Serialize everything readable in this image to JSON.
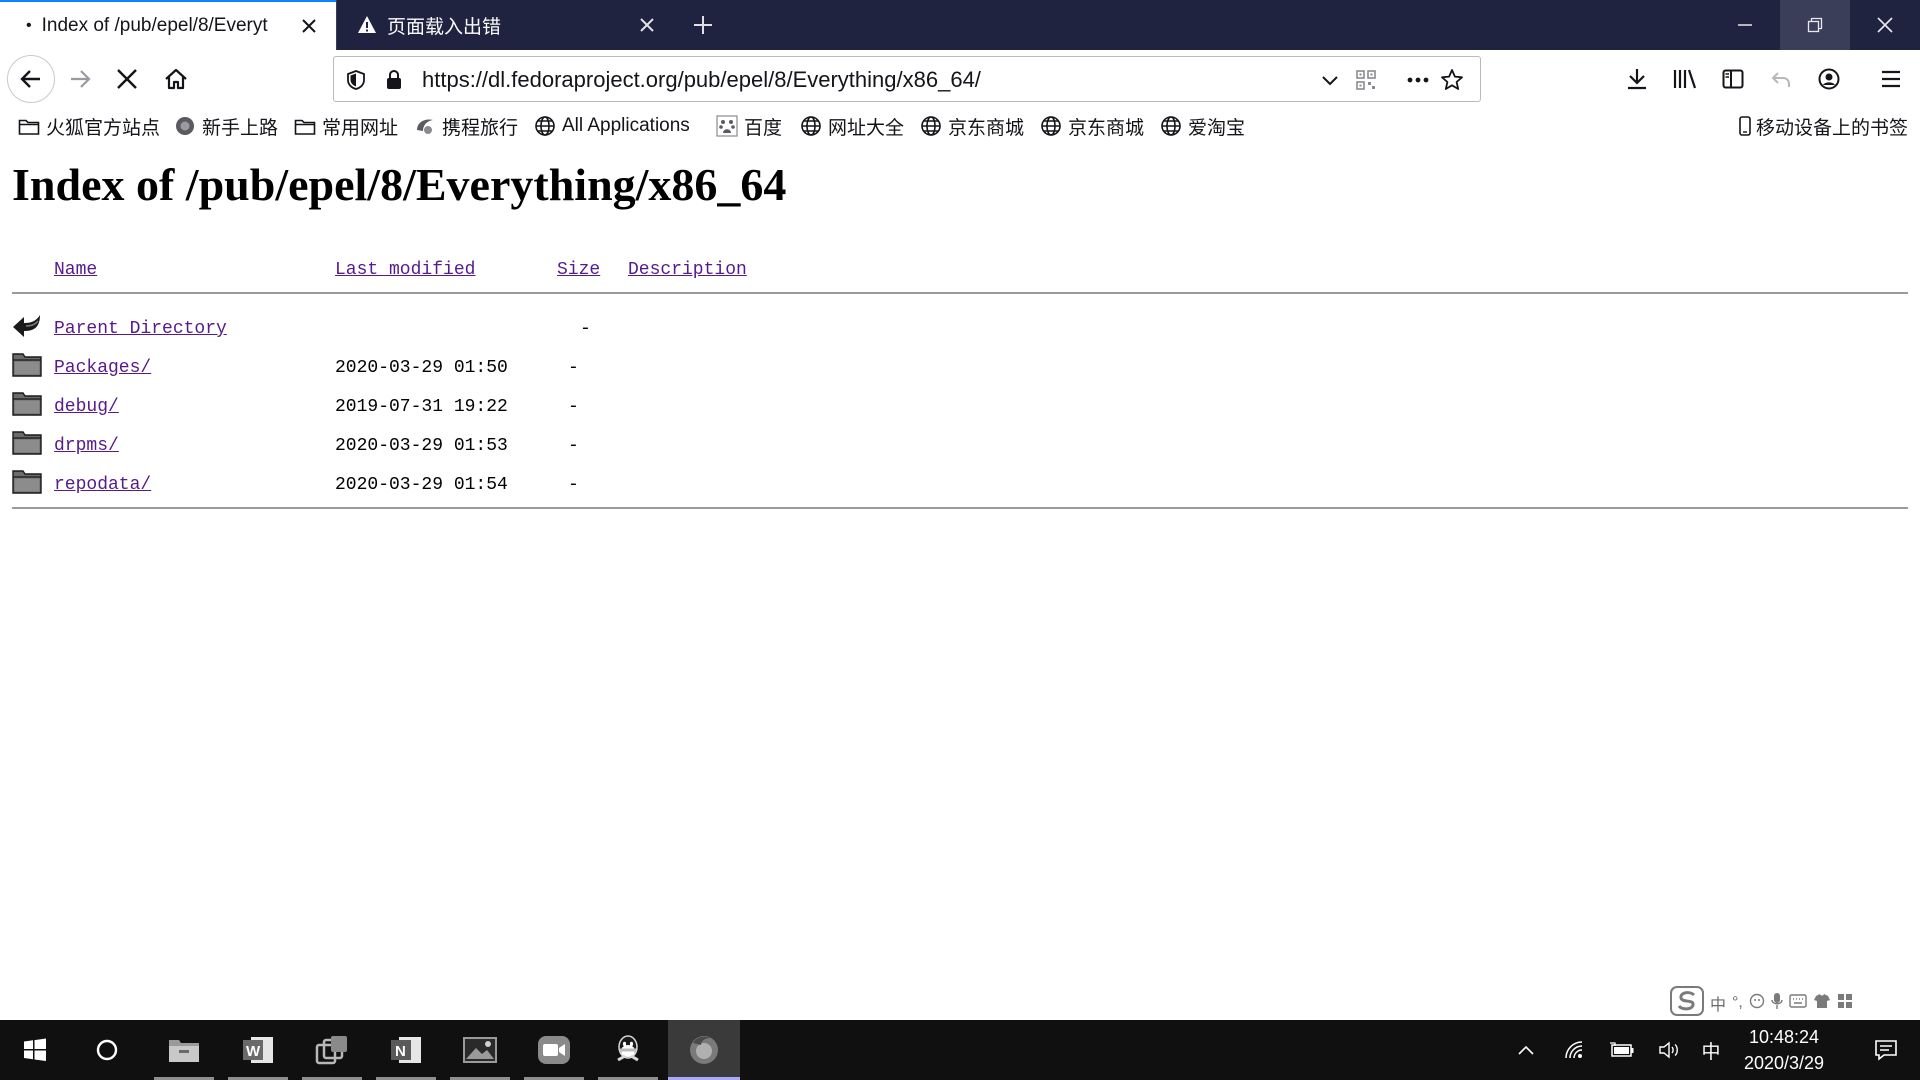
{
  "browser": {
    "tabs": [
      {
        "label": "Index of /pub/epel/8/Everyt",
        "state": "loading"
      },
      {
        "label": "页面载入出错",
        "state": "error"
      }
    ],
    "url": "https://dl.fedoraproject.org/pub/epel/8/Everything/x86_64/",
    "accent_color": "#0a84ff",
    "tabstrip_color": "#202340"
  },
  "bookmarks": {
    "items": [
      {
        "label": "火狐官方站点",
        "icon": "folder-icon"
      },
      {
        "label": "新手上路",
        "icon": "firefox-icon"
      },
      {
        "label": "常用网址",
        "icon": "folder-icon"
      },
      {
        "label": "携程旅行",
        "icon": "ctrip-icon"
      },
      {
        "label": "All Applications",
        "icon": "globe-icon"
      },
      {
        "label": "百度",
        "icon": "baidu-icon"
      },
      {
        "label": "网址大全",
        "icon": "globe-icon"
      },
      {
        "label": "京东商城",
        "icon": "globe-icon"
      },
      {
        "label": "京东商城",
        "icon": "globe-icon"
      },
      {
        "label": "爱淘宝",
        "icon": "globe-icon"
      }
    ],
    "mobile_label": "移动设备上的书签"
  },
  "page": {
    "title": "Index of /pub/epel/8/Everything/x86_64",
    "columns": {
      "name": "Name",
      "modified": "Last modified",
      "size": "Size",
      "description": "Description"
    },
    "entries": [
      {
        "name": "Parent Directory",
        "modified": "",
        "size": "-",
        "icon": "back-arrow-icon"
      },
      {
        "name": "Packages/",
        "modified": "2020-03-29 01:50",
        "size": "-",
        "icon": "folder-icon"
      },
      {
        "name": "debug/",
        "modified": "2019-07-31 19:22",
        "size": "-",
        "icon": "folder-icon"
      },
      {
        "name": "drpms/",
        "modified": "2020-03-29 01:53",
        "size": "-",
        "icon": "folder-icon"
      },
      {
        "name": "repodata/",
        "modified": "2020-03-29 01:54",
        "size": "-",
        "icon": "folder-icon"
      }
    ],
    "link_color": "#551a8b"
  },
  "ime": {
    "lang": "中"
  },
  "taskbar": {
    "apps": [
      "windows-start-icon",
      "cortana-icon",
      "file-explorer-icon",
      "word-icon",
      "task-view-icon",
      "onenote-icon",
      "photos-icon",
      "zoom-icon",
      "qq-icon",
      "firefox-icon"
    ],
    "input_lang": "中",
    "time": "10:48:24",
    "date": "2020/3/29"
  }
}
